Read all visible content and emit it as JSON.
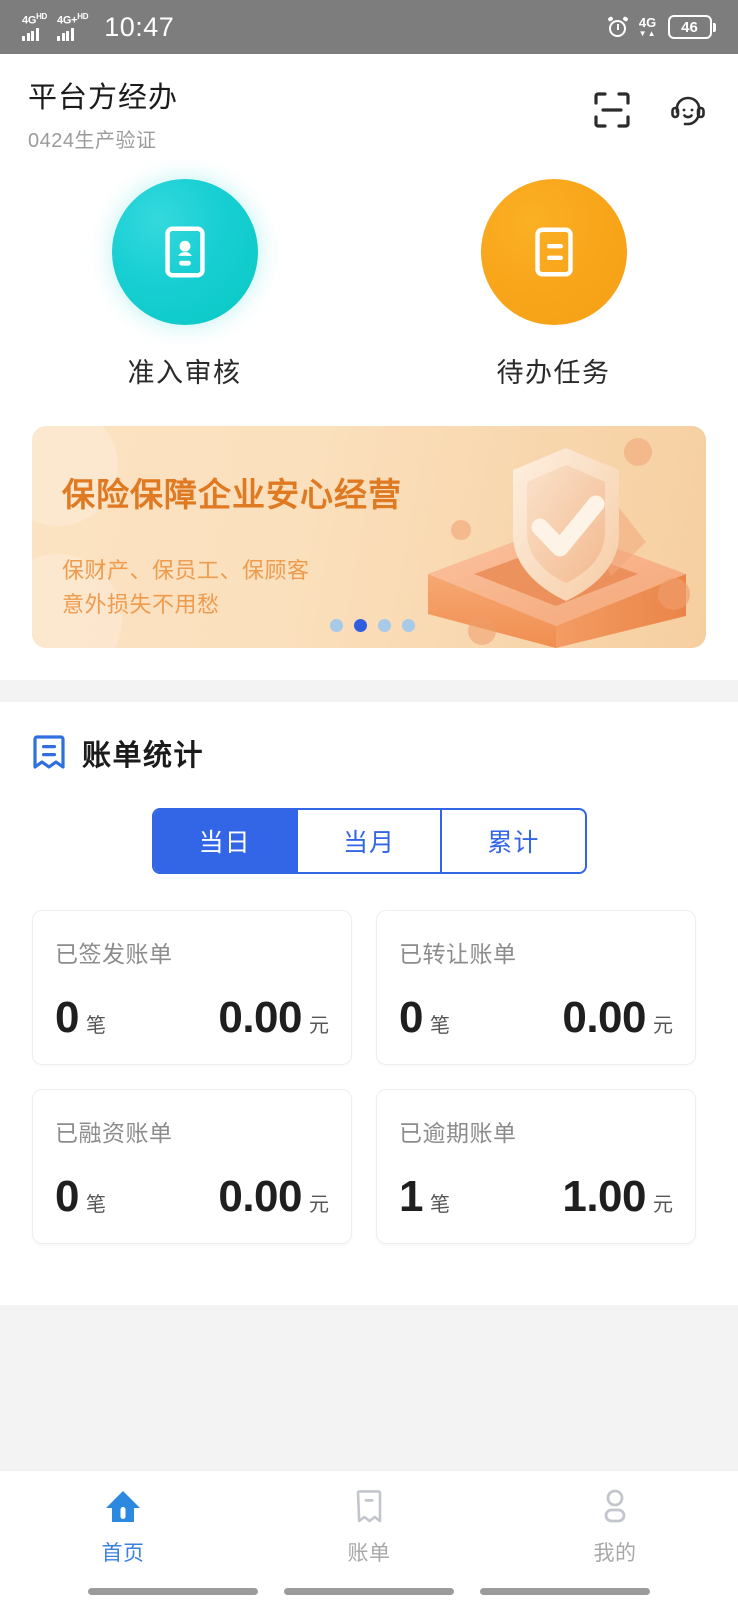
{
  "statusbar": {
    "carrier1": "4G",
    "carrier1_sup": "HD",
    "carrier2": "4G+",
    "carrier2_sup": "HD",
    "time": "10:47",
    "network": "4G",
    "network_arrows": "▼▲",
    "battery": "46",
    "alarm_icon": "alarm-clock-icon"
  },
  "header": {
    "title": "平台方经办",
    "subtitle": "0424生产验证",
    "scan_icon": "scan-icon",
    "support_icon": "customer-service-icon"
  },
  "entries": [
    {
      "label": "准入审核",
      "icon": "id-card-icon",
      "color": "#12cdcd"
    },
    {
      "label": "待办任务",
      "icon": "document-list-icon",
      "color": "#f9a61b"
    }
  ],
  "banner": {
    "title": "保险保障企业安心经营",
    "subtitle_line1": "保财产、保员工、保顾客",
    "subtitle_line2": "意外损失不用愁",
    "title_color": "#e07a22",
    "subtitle_color": "#ef9b4d",
    "dots_total": 4,
    "dot_active_index": 1,
    "illustration": "shield-check-in-box-illustration"
  },
  "stats": {
    "icon": "bill-receipt-icon",
    "title": "账单统计",
    "accent_color": "#3366e6",
    "tabs": [
      {
        "label": "当日",
        "active": true
      },
      {
        "label": "当月",
        "active": false
      },
      {
        "label": "累计",
        "active": false
      }
    ],
    "cards": [
      {
        "label": "已签发账单",
        "count": "0",
        "count_unit": "笔",
        "amount": "0.00",
        "amount_unit": "元"
      },
      {
        "label": "已转让账单",
        "count": "0",
        "count_unit": "笔",
        "amount": "0.00",
        "amount_unit": "元"
      },
      {
        "label": "已融资账单",
        "count": "0",
        "count_unit": "笔",
        "amount": "0.00",
        "amount_unit": "元"
      },
      {
        "label": "已逾期账单",
        "count": "1",
        "count_unit": "笔",
        "amount": "1.00",
        "amount_unit": "元"
      }
    ]
  },
  "tabbar": {
    "active_color": "#3b82e0",
    "inactive_color": "#a8a8a8",
    "items": [
      {
        "label": "首页",
        "icon": "home-icon",
        "active": true
      },
      {
        "label": "账单",
        "icon": "bill-icon",
        "active": false
      },
      {
        "label": "我的",
        "icon": "profile-icon",
        "active": false
      }
    ]
  }
}
